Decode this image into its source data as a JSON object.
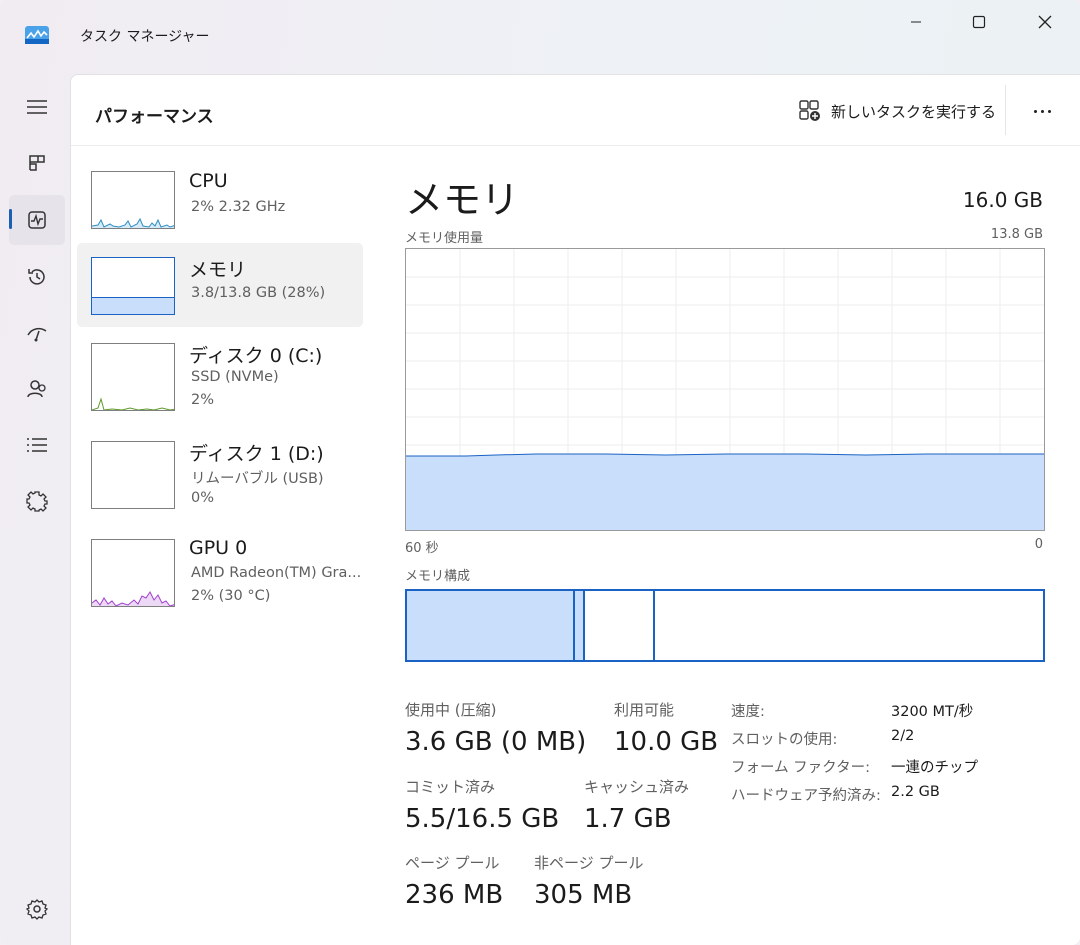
{
  "window": {
    "title": "タスク マネージャー"
  },
  "header": {
    "title": "パフォーマンス",
    "new_task": "新しいタスクを実行する",
    "more_icon": "more-icon"
  },
  "rail": {
    "items": [
      "hamburger-icon",
      "processes-icon",
      "performance-icon",
      "app-history-icon",
      "startup-icon",
      "users-icon",
      "details-icon",
      "services-icon"
    ],
    "settings": "settings-icon",
    "active": "performance-icon"
  },
  "devices": [
    {
      "name": "CPU",
      "sub1": "2% 2.32 GHz",
      "sub2": ""
    },
    {
      "name": "メモリ",
      "sub1": "3.8/13.8 GB (28%)",
      "sub2": ""
    },
    {
      "name": "ディスク 0 (C:)",
      "sub1": "SSD (NVMe)",
      "sub2": "2%"
    },
    {
      "name": "ディスク 1 (D:)",
      "sub1": "リムーバブル (USB)",
      "sub2": "0%"
    },
    {
      "name": "GPU 0",
      "sub1": "AMD Radeon(TM) Gra...",
      "sub2": "2% (30 °C)"
    }
  ],
  "main": {
    "title": "メモリ",
    "total": "16.0 GB",
    "usage_label": "メモリ使用量",
    "usage_max": "13.8 GB",
    "time_left": "60 秒",
    "time_right": "0",
    "composition_label": "メモリ構成",
    "usage_fill_fraction": 0.27
  },
  "stats": {
    "in_use_label": "使用中 (圧縮)",
    "in_use_value": "3.6 GB (0 MB)",
    "available_label": "利用可能",
    "available_value": "10.0 GB",
    "committed_label": "コミット済み",
    "committed_value": "5.5/16.5 GB",
    "cached_label": "キャッシュ済み",
    "cached_value": "1.7 GB",
    "paged_label": "ページ プール",
    "paged_value": "236 MB",
    "nonpaged_label": "非ページ プール",
    "nonpaged_value": "305 MB"
  },
  "details": [
    {
      "label": "速度:",
      "value": "3200 MT/秒"
    },
    {
      "label": "スロットの使用:",
      "value": "2/2"
    },
    {
      "label": "フォーム ファクター:",
      "value": "一連のチップ"
    },
    {
      "label": "ハードウェア予約済み:",
      "value": "2.2 GB"
    }
  ],
  "colors": {
    "accent": "#1a63c4",
    "memory_fill": "#c9defa",
    "cpu_line": "#2f8fc4",
    "disk_line": "#5d9b2b",
    "gpu_line": "#a23fcf"
  }
}
